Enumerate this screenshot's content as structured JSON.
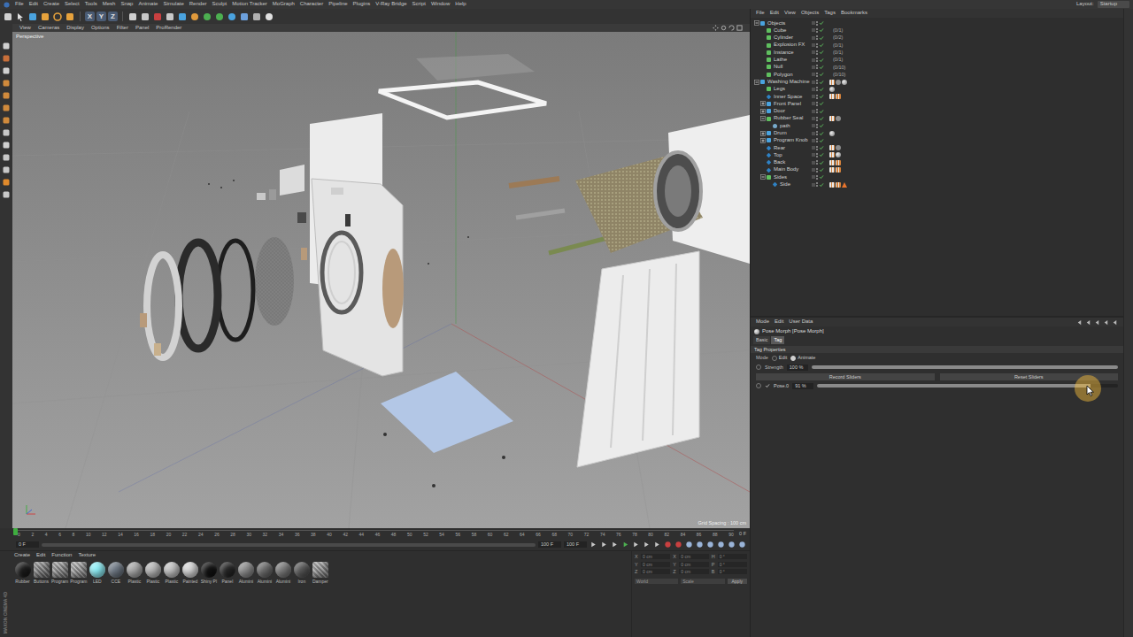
{
  "menubar": {
    "items": [
      "File",
      "Edit",
      "Create",
      "Select",
      "Tools",
      "Mesh",
      "Snap",
      "Animate",
      "Simulate",
      "Render",
      "Sculpt",
      "Motion Tracker",
      "MoGraph",
      "Character",
      "Pipeline",
      "Plugins",
      "V-Ray Bridge",
      "Script",
      "Window",
      "Help"
    ],
    "layout_label": "Layout:",
    "layout_value": "Startup"
  },
  "toolbar": {
    "axis_buttons": [
      {
        "label": "X",
        "on": true
      },
      {
        "label": "Y",
        "on": true
      },
      {
        "label": "Z",
        "on": true
      }
    ]
  },
  "viewport": {
    "menu": [
      "View",
      "Cameras",
      "Display",
      "Options",
      "Filter",
      "Panel",
      "ProRender"
    ],
    "camera": "Perspective",
    "grid_spacing": "Grid Spacing : 100 cm"
  },
  "timeline": {
    "ticks": [
      "0",
      "2",
      "4",
      "6",
      "8",
      "10",
      "12",
      "14",
      "16",
      "18",
      "20",
      "22",
      "24",
      "26",
      "28",
      "30",
      "32",
      "34",
      "36",
      "38",
      "40",
      "42",
      "44",
      "46",
      "48",
      "50",
      "52",
      "54",
      "56",
      "58",
      "60",
      "62",
      "64",
      "66",
      "68",
      "70",
      "72",
      "74",
      "76",
      "78",
      "80",
      "82",
      "84",
      "86",
      "88",
      "90"
    ],
    "ruler_end": "0 F",
    "start_field": "0 F",
    "end_field": "100 F",
    "max_field": "100 F"
  },
  "materials": {
    "menu": [
      "Create",
      "Edit",
      "Function",
      "Texture"
    ],
    "items": [
      {
        "name": "Rubber",
        "color": "#1c1c1c",
        "kind": "plain"
      },
      {
        "name": "Buttons",
        "color": "#8a8a8a",
        "kind": "texture"
      },
      {
        "name": "Program",
        "color": "#9a9a9a",
        "kind": "texture"
      },
      {
        "name": "Program",
        "color": "#a5a5a5",
        "kind": "texture"
      },
      {
        "name": "LED",
        "color": "#8ff0f8",
        "kind": "plain"
      },
      {
        "name": "CCE",
        "color": "#6e7884",
        "kind": "plain"
      },
      {
        "name": "Plastic",
        "color": "#a8a8a8",
        "kind": "plain"
      },
      {
        "name": "Plastic",
        "color": "#b8b8b8",
        "kind": "plain"
      },
      {
        "name": "Plastic",
        "color": "#c4c4c4",
        "kind": "plain"
      },
      {
        "name": "Painted",
        "color": "#d8d8d8",
        "kind": "plain"
      },
      {
        "name": "Shiny Pl",
        "color": "#121212",
        "kind": "plain"
      },
      {
        "name": "Panel",
        "color": "#262626",
        "kind": "plain"
      },
      {
        "name": "Alumini",
        "color": "#8c8c8c",
        "kind": "plain"
      },
      {
        "name": "Alumini",
        "color": "#6c6c6c",
        "kind": "plain"
      },
      {
        "name": "Alumini",
        "color": "#7a7a7a",
        "kind": "plain"
      },
      {
        "name": "Iron",
        "color": "#585858",
        "kind": "plain"
      },
      {
        "name": "Damper",
        "color": "#9c9c9c",
        "kind": "texture"
      }
    ]
  },
  "logo": "MAXON CINEMA 4D",
  "coordinates": {
    "columns": [
      {
        "rows": [
          {
            "axis": "X",
            "value": "0 cm"
          },
          {
            "axis": "Y",
            "value": "0 cm"
          },
          {
            "axis": "Z",
            "value": "0 cm"
          }
        ]
      },
      {
        "rows": [
          {
            "axis": "X",
            "value": "0 cm"
          },
          {
            "axis": "Y",
            "value": "0 cm"
          },
          {
            "axis": "Z",
            "value": "0 cm"
          }
        ]
      },
      {
        "rows": [
          {
            "axis": "H",
            "value": "0 °"
          },
          {
            "axis": "P",
            "value": "0 °"
          },
          {
            "axis": "B",
            "value": "0 °"
          }
        ]
      }
    ],
    "dropdowns": [
      "World",
      "Scale"
    ],
    "apply": "Apply"
  },
  "object_manager": {
    "menu": [
      "File",
      "Edit",
      "View",
      "Objects",
      "Tags",
      "Bookmarks"
    ],
    "objects": [
      {
        "name": "Objects",
        "depth": 0,
        "kind": "null",
        "expandable": true,
        "expanded": true,
        "selected": false,
        "info": "",
        "tags": []
      },
      {
        "name": "Cube",
        "depth": 1,
        "kind": "object",
        "expandable": false,
        "expanded": false,
        "selected": false,
        "info": "(0/1)",
        "tags": []
      },
      {
        "name": "Cylinder",
        "depth": 1,
        "kind": "object",
        "expandable": false,
        "expanded": false,
        "selected": false,
        "info": "(0/2)",
        "tags": []
      },
      {
        "name": "Explosion FX",
        "depth": 1,
        "kind": "object",
        "expandable": false,
        "expanded": false,
        "selected": false,
        "info": "(0/1)",
        "tags": []
      },
      {
        "name": "Instance",
        "depth": 1,
        "kind": "object",
        "expandable": false,
        "expanded": false,
        "selected": false,
        "info": "(0/1)",
        "tags": []
      },
      {
        "name": "Lathe",
        "depth": 1,
        "kind": "object",
        "expandable": false,
        "expanded": false,
        "selected": false,
        "info": "(0/1)",
        "tags": []
      },
      {
        "name": "Null",
        "depth": 1,
        "kind": "object",
        "expandable": false,
        "expanded": false,
        "selected": false,
        "info": "(0/10)",
        "tags": []
      },
      {
        "name": "Polygon",
        "depth": 1,
        "kind": "object",
        "expandable": false,
        "expanded": false,
        "selected": false,
        "info": "(0/10)",
        "tags": []
      },
      {
        "name": "Washing Machine",
        "depth": 0,
        "kind": "null",
        "expandable": true,
        "expanded": true,
        "selected": false,
        "info": "",
        "tags": [
          "texture",
          "phong",
          "material"
        ]
      },
      {
        "name": "Legs",
        "depth": 1,
        "kind": "object",
        "expandable": false,
        "expanded": false,
        "selected": false,
        "info": "",
        "tags": [
          "material"
        ]
      },
      {
        "name": "Inner Space",
        "depth": 1,
        "kind": "polygon",
        "expandable": false,
        "expanded": false,
        "selected": false,
        "info": "",
        "tags": [
          "texture",
          "texture"
        ]
      },
      {
        "name": "Front Panel",
        "depth": 1,
        "kind": "null",
        "expandable": true,
        "expanded": false,
        "selected": false,
        "info": "",
        "tags": []
      },
      {
        "name": "Door",
        "depth": 1,
        "kind": "null",
        "expandable": true,
        "expanded": false,
        "selected": false,
        "info": "",
        "tags": []
      },
      {
        "name": "Rubber Seal",
        "depth": 1,
        "kind": "object",
        "expandable": true,
        "expanded": true,
        "selected": false,
        "info": "",
        "tags": [
          "texture",
          "phong"
        ]
      },
      {
        "name": "path",
        "depth": 2,
        "kind": "spline",
        "expandable": false,
        "expanded": false,
        "selected": false,
        "info": "",
        "tags": []
      },
      {
        "name": "Drum",
        "depth": 1,
        "kind": "null",
        "expandable": true,
        "expanded": false,
        "selected": false,
        "info": "",
        "tags": [
          "material"
        ]
      },
      {
        "name": "Program Knob",
        "depth": 1,
        "kind": "null",
        "expandable": true,
        "expanded": false,
        "selected": false,
        "info": "",
        "tags": []
      },
      {
        "name": "Rear",
        "depth": 1,
        "kind": "polygon",
        "expandable": false,
        "expanded": false,
        "selected": false,
        "info": "",
        "tags": [
          "texture",
          "phong"
        ]
      },
      {
        "name": "Top",
        "depth": 1,
        "kind": "polygon",
        "expandable": false,
        "expanded": false,
        "selected": false,
        "info": "",
        "tags": [
          "texture",
          "material"
        ]
      },
      {
        "name": "Back",
        "depth": 1,
        "kind": "polygon",
        "expandable": false,
        "expanded": false,
        "selected": false,
        "info": "",
        "tags": [
          "texture",
          "texture"
        ]
      },
      {
        "name": "Main Body",
        "depth": 1,
        "kind": "polygon",
        "expandable": false,
        "expanded": false,
        "selected": false,
        "info": "",
        "tags": [
          "texture",
          "texture"
        ]
      },
      {
        "name": "Sides",
        "depth": 1,
        "kind": "object",
        "expandable": true,
        "expanded": true,
        "selected": false,
        "info": "",
        "tags": []
      },
      {
        "name": "Side",
        "depth": 2,
        "kind": "polygon",
        "expandable": false,
        "expanded": false,
        "selected": false,
        "info": "",
        "tags": [
          "texture",
          "texture",
          "warning"
        ]
      }
    ]
  },
  "attribute_manager": {
    "menu": [
      "Mode",
      "Edit",
      "User Data"
    ],
    "title": "Pose Morph [Pose Morph]",
    "tabs": [
      {
        "label": "Basic",
        "selected": false
      },
      {
        "label": "Tag",
        "selected": true
      }
    ],
    "section": "Tag Properties",
    "mode": {
      "label": "Mode",
      "options": [
        {
          "label": "Edit",
          "selected": false
        },
        {
          "label": "Animate",
          "selected": true
        }
      ]
    },
    "strength": {
      "label": "Strength",
      "value": "100 %",
      "level": 1.0
    },
    "buttons": [
      "Record Sliders",
      "Reset Sliders"
    ],
    "poses": [
      {
        "name": "Pose.0",
        "value": "91 %",
        "level": 0.91,
        "enabled": true
      }
    ]
  }
}
